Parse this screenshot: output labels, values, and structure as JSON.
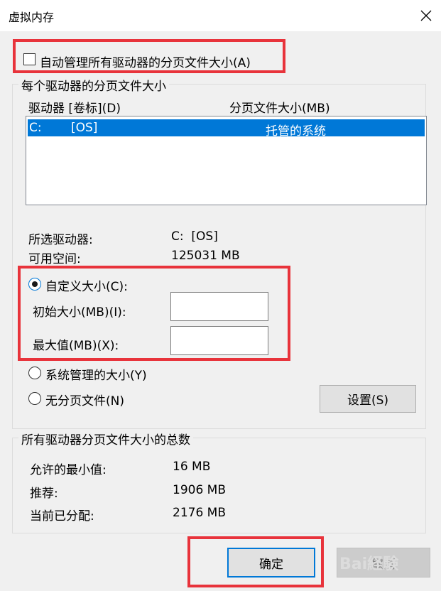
{
  "window": {
    "title": "虚拟内存"
  },
  "auto_manage": {
    "label": "自动管理所有驱动器的分页文件大小(A)",
    "checked": false
  },
  "per_drive": {
    "group_label": "每个驱动器的分页文件大小",
    "col_drive": "驱动器 [卷标](D)",
    "col_size": "分页文件大小(MB)",
    "rows": [
      {
        "drive": "C:",
        "label": "[OS]",
        "size": "托管的系统"
      }
    ],
    "selected_drive_label": "所选驱动器:",
    "selected_drive_value": "C:  [OS]",
    "free_space_label": "可用空间:",
    "free_space_value": "125031 MB",
    "custom_size_label": "自定义大小(C):",
    "initial_size_label": "初始大小(MB)(I):",
    "initial_size_value": "",
    "max_size_label": "最大值(MB)(X):",
    "max_size_value": "",
    "system_managed_label": "系统管理的大小(Y)",
    "no_paging_label": "无分页文件(N)",
    "set_button": "设置(S)",
    "selected_option": "custom"
  },
  "totals": {
    "group_label": "所有驱动器分页文件大小的总数",
    "min_label": "允许的最小值:",
    "min_value": "16 MB",
    "recommended_label": "推荐:",
    "recommended_value": "1906 MB",
    "current_label": "当前已分配:",
    "current_value": "2176 MB"
  },
  "buttons": {
    "ok": "确定",
    "cancel": "取消"
  },
  "watermark": {
    "text": "Bai経験"
  },
  "colors": {
    "highlight": "#e8333b",
    "selection": "#0078d7"
  },
  "icons": {
    "close": "close-icon"
  }
}
